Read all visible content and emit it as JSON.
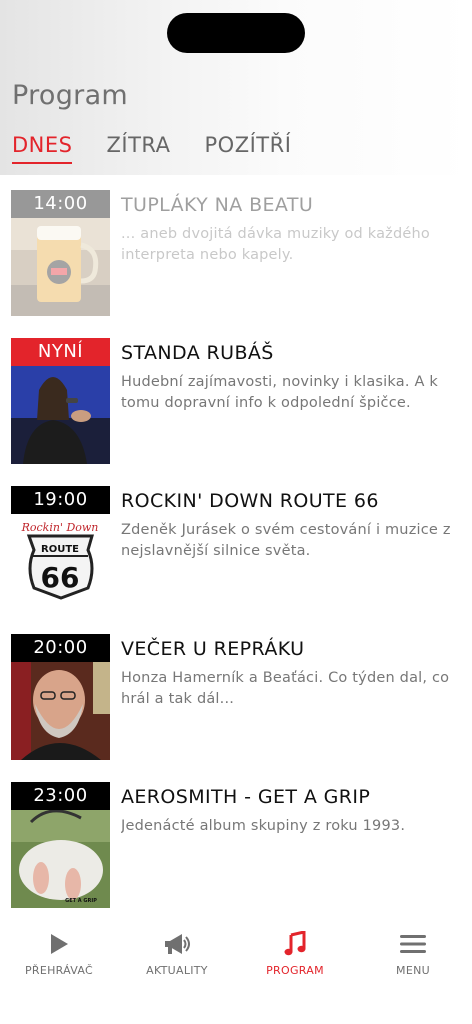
{
  "header": {
    "title": "Program",
    "tabs": [
      {
        "label": "DNES",
        "active": true
      },
      {
        "label": "ZÍTRA",
        "active": false
      },
      {
        "label": "POZÍTŘÍ",
        "active": false
      }
    ]
  },
  "schedule": [
    {
      "time": "14:00",
      "title": "TUPLÁKY NA BEATU",
      "desc_line1": "... aneb dvojitá dávka muziky od každého",
      "desc_line2": "interpreta nebo kapely.",
      "state": "past",
      "image": "beer-mug-beat-logo"
    },
    {
      "time": "NYNÍ",
      "title": "STANDA RUBÁŠ",
      "desc_line1": "Hudební zajímavosti, novinky i klasika. A k",
      "desc_line2": "tomu dopravní info k odpolední špičce.",
      "state": "now",
      "image": "singer-with-microphone"
    },
    {
      "time": "19:00",
      "title": "ROCKIN' DOWN ROUTE 66",
      "desc_line1": "Zdeněk Jurásek o svém cestování i muzice z",
      "desc_line2": "nejslavnější silnice světa.",
      "state": "upcoming",
      "image": "route-66-sign",
      "image_text_script": "Rockin' Down",
      "image_text_top": "ROUTE",
      "image_text_num": "66"
    },
    {
      "time": "20:00",
      "title": "VEČER U REPRÁKU",
      "desc_line1": "Honza Hamerník a Beaťáci. Co týden dal, co",
      "desc_line2": "hrál a tak dál...",
      "state": "upcoming",
      "image": "bearded-host-portrait"
    },
    {
      "time": "23:00",
      "title": "AEROSMITH - GET A GRIP",
      "desc_line1": "Jedenácté album skupiny z roku 1993.",
      "desc_line2": "",
      "state": "upcoming",
      "image": "get-a-grip-album-cover",
      "image_text": "GET A GRIP"
    }
  ],
  "tabbar": {
    "items": [
      {
        "label": "PŘEHRÁVAČ",
        "icon": "play-icon",
        "active": false
      },
      {
        "label": "AKTUALITY",
        "icon": "megaphone-icon",
        "active": false
      },
      {
        "label": "PROGRAM",
        "icon": "music-note-icon",
        "active": true
      },
      {
        "label": "MENU",
        "icon": "hamburger-menu-icon",
        "active": false
      }
    ]
  },
  "colors": {
    "accent": "#e3242b",
    "muted": "#707070",
    "time_bg": "#000000"
  }
}
